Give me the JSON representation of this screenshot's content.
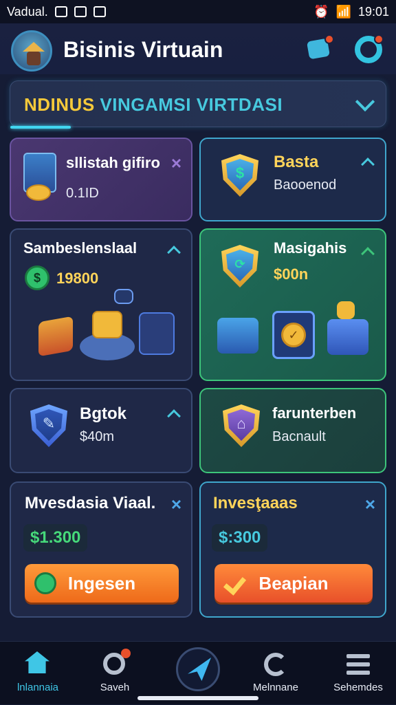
{
  "status": {
    "carrier": "Vadual.",
    "time": "19:01"
  },
  "header": {
    "title": "Bisinis Virtuain"
  },
  "banner": {
    "part1": "NDINUS",
    "part2": "VINGAMSI VIRTDASI"
  },
  "cards": {
    "c1": {
      "title": "sllistah gifiro",
      "value": "0.1ID"
    },
    "c2": {
      "title": "Basta",
      "sub": "Baooenod"
    },
    "c3": {
      "title": "Sambeslenslaal",
      "amount": "19800"
    },
    "c4": {
      "title": "Masigahis",
      "amount": "$00n"
    },
    "c5": {
      "title": "Bgtok",
      "sub": "$40m"
    },
    "c6": {
      "title": "farunterben",
      "sub": "Bacnault"
    },
    "c7": {
      "title": "Mvesdasia Viaal.",
      "amount": "$1.300",
      "button": "Ingesen"
    },
    "c8": {
      "title": "Invesţaaas",
      "amount": "$:300",
      "button": "Beapian"
    }
  },
  "nav": {
    "home": "lnlannaia",
    "search": "Saveh",
    "refresh": "Melnnane",
    "menu": "Sehemdes"
  },
  "colors": {
    "accent": "#3fc6e6",
    "gold": "#ffd45a",
    "green": "#3dc57a",
    "orange": "#ee6a1a"
  }
}
